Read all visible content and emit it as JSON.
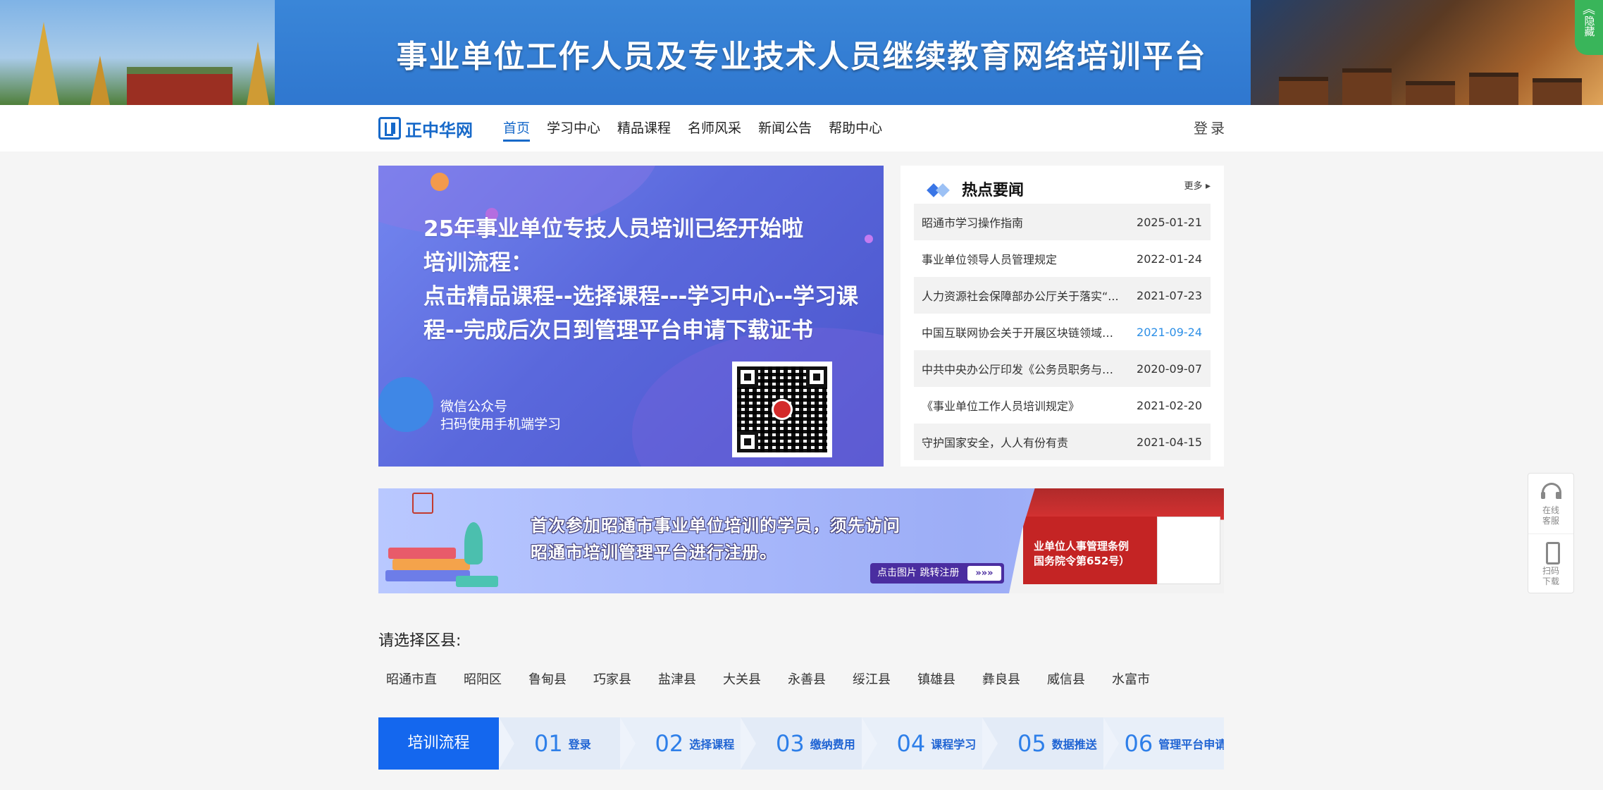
{
  "banner": {
    "title": "事业单位工作人员及专业技术人员继续教育网络培训平台",
    "hide_tab_label": "隐藏",
    "hide_tab_icon": "double-chevron-up-icon"
  },
  "nav": {
    "logo_text": "正中华网",
    "links": [
      "首页",
      "学习中心",
      "精品课程",
      "名师风采",
      "新闻公告",
      "帮助中心"
    ],
    "active_index": 0,
    "login_label": "登录",
    "accent_color": "#1769c9"
  },
  "hero": {
    "headline_lines": [
      "25年事业单位专技人员培训已经开始啦",
      "培训流程：",
      "点击精品课程--选择课程---学习中心--学习课",
      "程--完成后次日到管理平台申请下载证书"
    ],
    "sub_lines": [
      "微信公众号",
      "扫码使用手机端学习"
    ]
  },
  "news": {
    "title": "热点要闻",
    "more_label": "更多",
    "items": [
      {
        "title": "昭通市学习操作指南",
        "date": "2025-01-21",
        "highlight": false
      },
      {
        "title": "事业单位领导人员管理规定",
        "date": "2022-01-24",
        "highlight": false
      },
      {
        "title": "人力资源社会保障部办公厅关于落实“...",
        "date": "2021-07-23",
        "highlight": false
      },
      {
        "title": "中国互联网协会关于开展区块链领域相...",
        "date": "2021-09-24",
        "highlight": true
      },
      {
        "title": "中共中央办公厅印发《公务员职务与职...",
        "date": "2020-09-07",
        "highlight": false
      },
      {
        "title": "《事业单位工作人员培训规定》",
        "date": "2021-02-20",
        "highlight": false
      },
      {
        "title": "守护国家安全，人人有份有责",
        "date": "2021-04-15",
        "highlight": false
      }
    ]
  },
  "promo": {
    "lines": [
      "首次参加昭通市事业单位培训的学员，须先访问",
      "昭通市培训管理平台进行注册。"
    ],
    "button_label": "点击图片 跳转注册",
    "button_arrows": "»»»",
    "screenshot_lines": [
      "业单位人事管理条例",
      "国务院令第652号）"
    ]
  },
  "district": {
    "label": "请选择区县:",
    "items": [
      "昭通市直",
      "昭阳区",
      "鲁甸县",
      "巧家县",
      "盐津县",
      "大关县",
      "永善县",
      "绥江县",
      "镇雄县",
      "彝良县",
      "威信县",
      "水富市"
    ]
  },
  "process": {
    "title": "培训流程",
    "steps": [
      {
        "num": "01",
        "label": "登录"
      },
      {
        "num": "02",
        "label": "选择课程"
      },
      {
        "num": "03",
        "label": "缴纳费用"
      },
      {
        "num": "04",
        "label": "课程学习"
      },
      {
        "num": "05",
        "label": "数据推送"
      },
      {
        "num": "06",
        "label": "管理平台申请证书"
      }
    ]
  },
  "side_widget": {
    "items": [
      {
        "icon": "headset-icon",
        "lines": [
          "在线",
          "客服"
        ]
      },
      {
        "icon": "phone-icon",
        "lines": [
          "扫码",
          "下载"
        ]
      }
    ]
  }
}
